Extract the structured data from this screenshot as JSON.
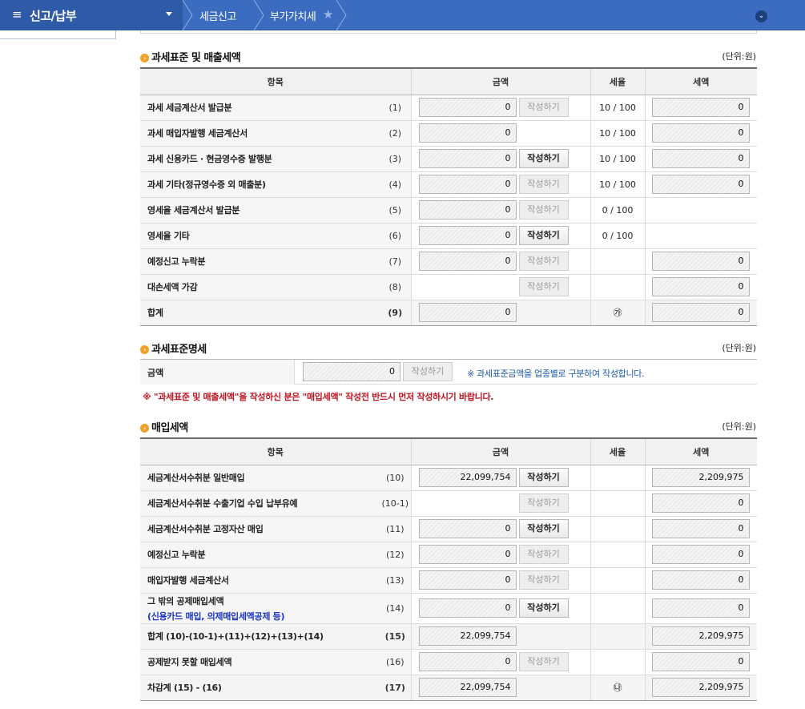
{
  "nav": {
    "menu_title": "신고/납부",
    "breadcrumbs": [
      "세금신고",
      "부가가치세"
    ]
  },
  "colors": {
    "nav_bg": "#3b6cbf",
    "accent_bullet": "#f0a12a",
    "warn_text": "#c1121f",
    "note_text": "#1d5aa8",
    "sub_label": "#1a35c4"
  },
  "sales": {
    "title": "과세표준 및 매출세액",
    "unit": "(단위:원)",
    "headers": {
      "item": "항목",
      "amount": "금액",
      "rate": "세율",
      "tax": "세액"
    },
    "rows": [
      {
        "label": "과세 세금계산서 발급분",
        "no": "(1)",
        "amount": "0",
        "button": "작성하기",
        "button_enabled": false,
        "rate": "10 / 100",
        "tax": "0"
      },
      {
        "label": "과세 매입자발행 세금계산서",
        "no": "(2)",
        "amount": "0",
        "rate": "10 / 100",
        "tax": "0"
      },
      {
        "label": "과세 신용카드 · 현금영수증 발행분",
        "no": "(3)",
        "amount": "0",
        "button": "작성하기",
        "button_enabled": true,
        "rate": "10 / 100",
        "tax": "0"
      },
      {
        "label": "과세 기타(정규영수증 외 매출분)",
        "no": "(4)",
        "amount": "0",
        "button": "작성하기",
        "button_enabled": false,
        "rate": "10 / 100",
        "tax": "0"
      },
      {
        "label": "영세율 세금계산서 발급분",
        "no": "(5)",
        "amount": "0",
        "button": "작성하기",
        "button_enabled": false,
        "rate": "0 / 100"
      },
      {
        "label": "영세율 기타",
        "no": "(6)",
        "amount": "0",
        "button": "작성하기",
        "button_enabled": true,
        "rate": "0 / 100"
      },
      {
        "label": "예정신고 누락분",
        "no": "(7)",
        "amount": "0",
        "button": "작성하기",
        "button_enabled": false,
        "tax": "0"
      },
      {
        "label": "대손세액 가감",
        "no": "(8)",
        "button": "작성하기",
        "button_enabled": false,
        "tax": "0"
      },
      {
        "label": "합계",
        "no": "(9)",
        "amount": "0",
        "rate": "㉮",
        "tax": "0",
        "sum": true
      }
    ]
  },
  "base": {
    "title": "과세표준명세",
    "unit": "(단위:원)",
    "label": "금액",
    "amount": "0",
    "button": "작성하기",
    "note": "※ 과세표준금액을 업종별로 구분하여 작성합니다.",
    "warning": "※ \"과세표준 및 매출세액\"을 작성하신 분은 \"매입세액\" 작성전 반드시 먼저 작성하시기 바랍니다."
  },
  "purchase": {
    "title": "매입세액",
    "unit": "(단위:원)",
    "headers": {
      "item": "항목",
      "amount": "금액",
      "rate": "세율",
      "tax": "세액"
    },
    "rows": [
      {
        "label": "세금계산서수취분 일반매입",
        "no": "(10)",
        "amount": "22,099,754",
        "button": "작성하기",
        "button_enabled": true,
        "tax": "2,209,975"
      },
      {
        "label": "세금계산서수취분 수출기업 수입 납부유예",
        "no": "(10-1)",
        "button": "작성하기",
        "button_enabled": false,
        "tax": "0"
      },
      {
        "label": "세금계산서수취분 고정자산 매입",
        "no": "(11)",
        "amount": "0",
        "button": "작성하기",
        "button_enabled": true,
        "tax": "0"
      },
      {
        "label": "예정신고 누락분",
        "no": "(12)",
        "amount": "0",
        "button": "작성하기",
        "button_enabled": false,
        "tax": "0"
      },
      {
        "label": "매입자발행 세금계산서",
        "no": "(13)",
        "amount": "0",
        "button": "작성하기",
        "button_enabled": false,
        "tax": "0"
      },
      {
        "label": "그 밖의 공제매입세액",
        "sublabel": "(신용카드 매입, 의제매입세액공제 등)",
        "no": "(14)",
        "amount": "0",
        "button": "작성하기",
        "button_enabled": true,
        "tax": "0"
      },
      {
        "label": "합계 (10)-(10-1)+(11)+(12)+(13)+(14)",
        "no": "(15)",
        "amount": "22,099,754",
        "tax": "2,209,975",
        "sum": true
      },
      {
        "label": "공제받지 못할 매입세액",
        "no": "(16)",
        "amount": "0",
        "button": "작성하기",
        "button_enabled": false,
        "tax": "0"
      },
      {
        "label": "차감계 (15) - (16)",
        "no": "(17)",
        "amount": "22,099,754",
        "rate": "㉯",
        "tax": "2,209,975",
        "sum": true
      }
    ]
  }
}
